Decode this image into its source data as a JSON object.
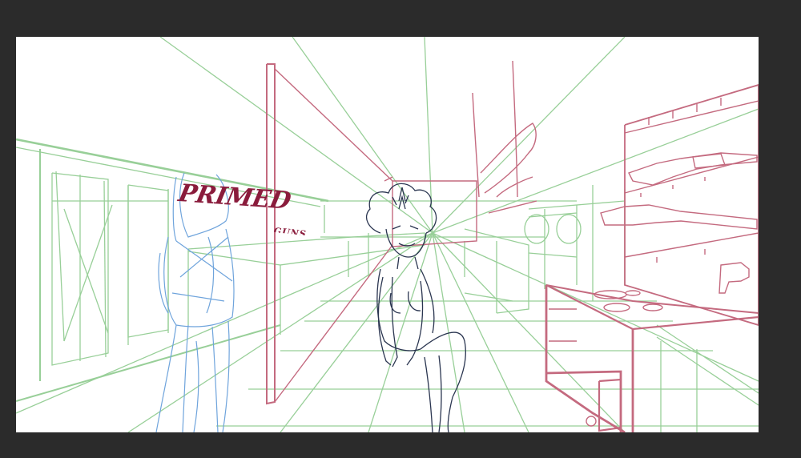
{
  "app": {
    "workspace_background": "#2b2b2b",
    "canvas_background": "#ffffff"
  },
  "artwork": {
    "sign": {
      "title": "PRIMED",
      "subtitle": "GUNS",
      "color": "#8a1c3c"
    },
    "layer_colors": {
      "perspective_guides": "#98cf98",
      "environment_sketch": "#c46a7f",
      "background_figure": "#6fa4dc",
      "foreground_figure": "#2a3550"
    }
  }
}
